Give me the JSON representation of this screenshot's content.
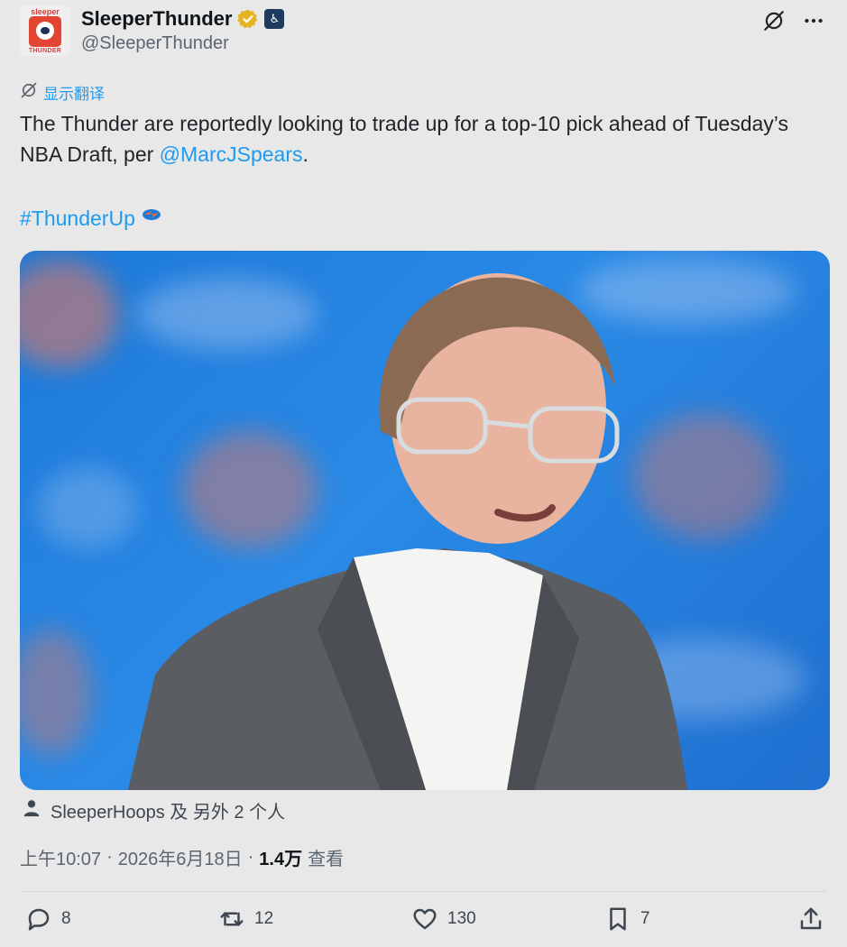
{
  "author": {
    "display_name": "SleeperThunder",
    "handle": "@SleeperThunder",
    "avatar_top_text": "sleeper",
    "avatar_bottom_text": "THUNDER",
    "verified_color": "#e6b422"
  },
  "top_actions": {
    "grok_icon": "grok-icon",
    "more_icon": "more-icon"
  },
  "translate": {
    "label": "显示翻译"
  },
  "tweet": {
    "text_before_mention": "The Thunder are reportedly looking to trade up for a top-10 pick ahead of Tuesday’s NBA Draft, per ",
    "mention": "@MarcJSpears",
    "text_after_mention": ".",
    "hashtag": "#ThunderUp"
  },
  "liked_by": {
    "text": "SleeperHoops 及 另外 2 个人"
  },
  "meta": {
    "time": "上午10:07",
    "sep1": "·",
    "date": "2026年6月18日",
    "sep2": "·",
    "views_num": "1.4万",
    "views_label": "查看"
  },
  "actions": {
    "reply_count": "8",
    "retweet_count": "12",
    "like_count": "130",
    "bookmark_count": "7"
  },
  "colors": {
    "accent": "#1d9bf0",
    "background": "#e8e8e8",
    "photo_blue": "#1c78d8"
  }
}
